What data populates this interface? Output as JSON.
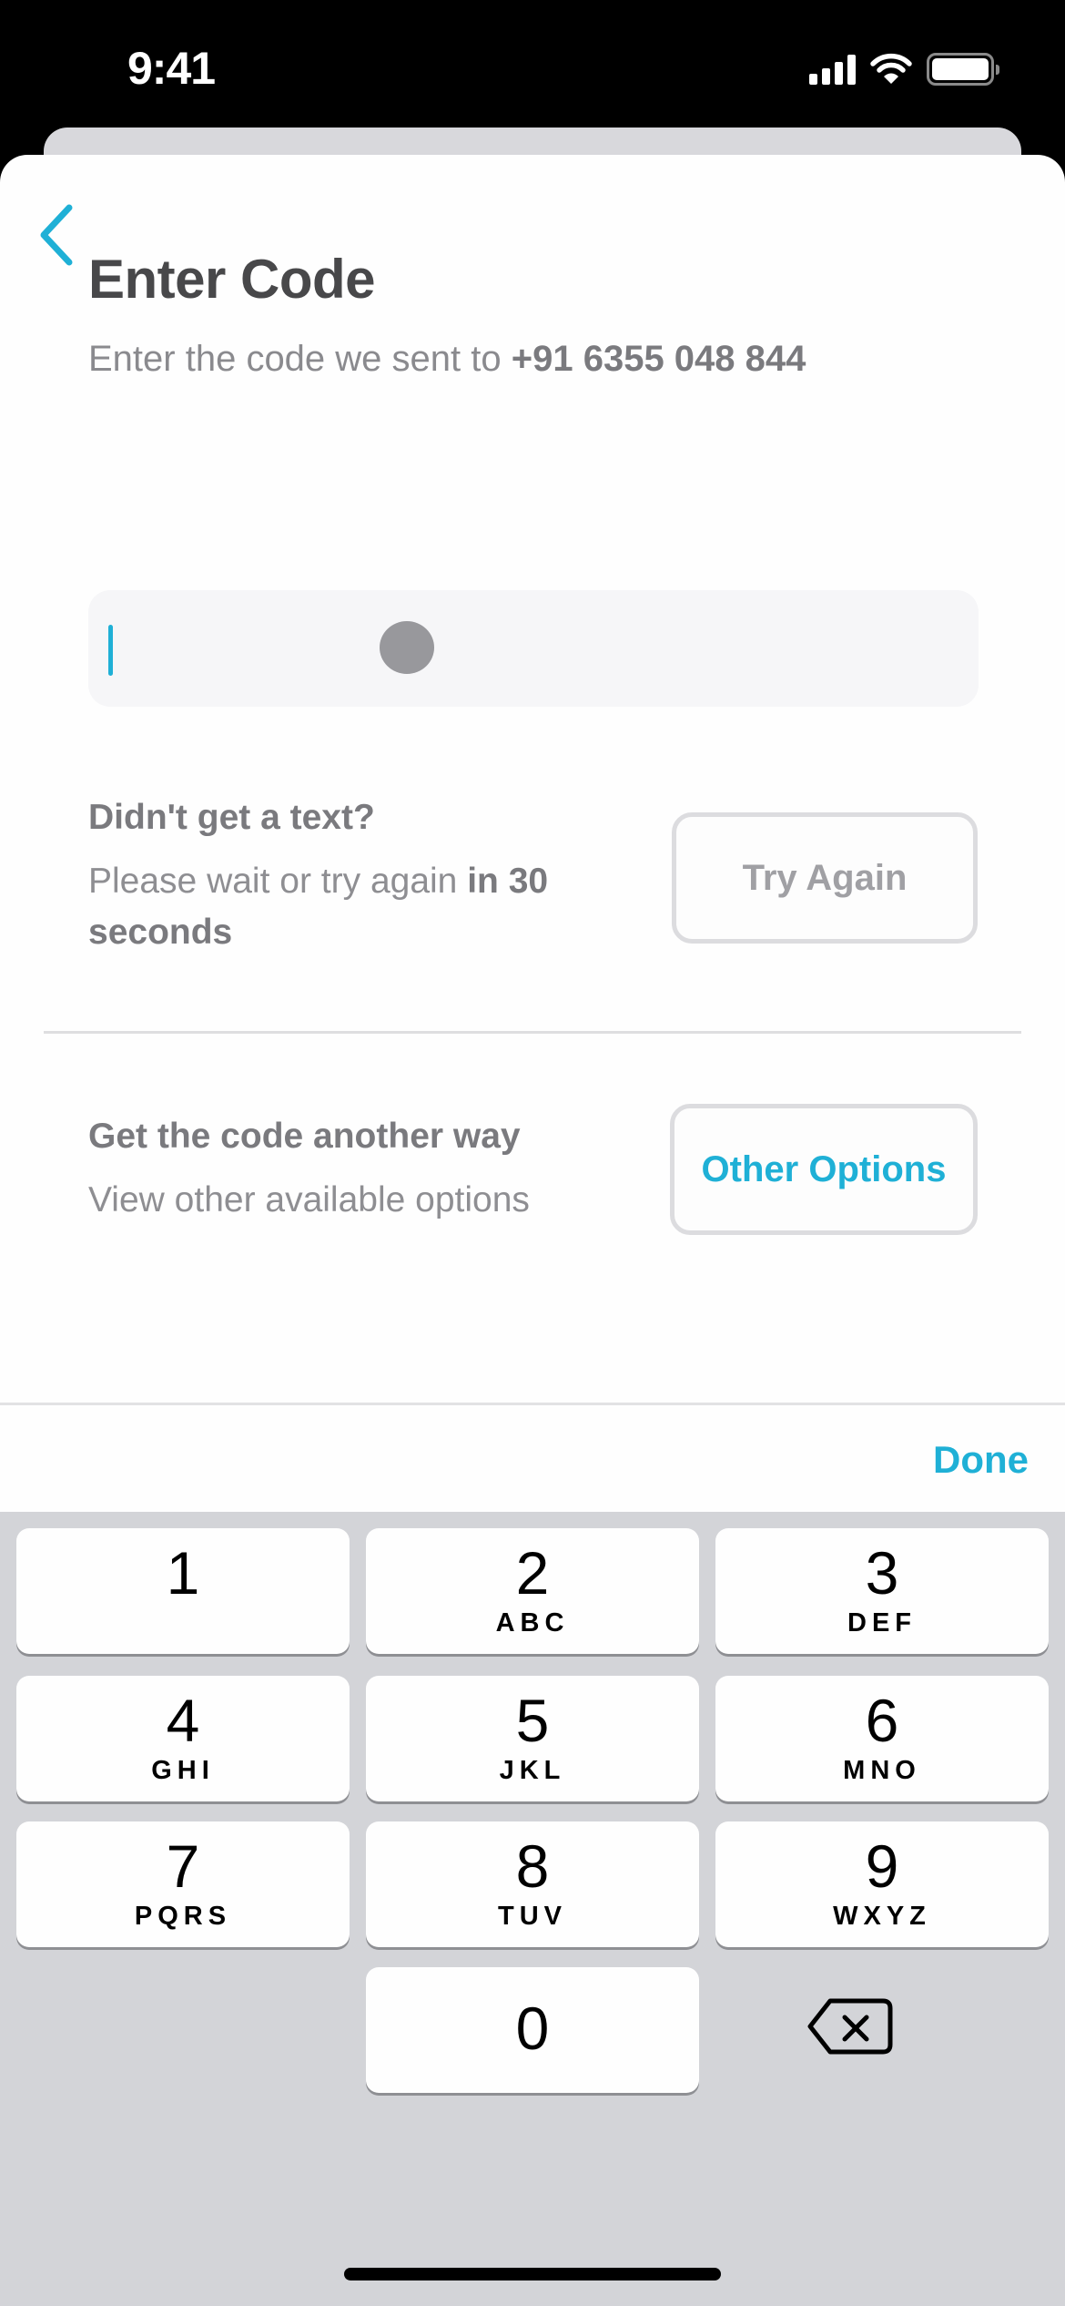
{
  "status_bar": {
    "time": "9:41",
    "icons": [
      "cellular-signal-icon",
      "wifi-icon",
      "battery-icon"
    ]
  },
  "header": {
    "back_icon": "chevron-left-icon"
  },
  "main": {
    "title": "Enter Code",
    "subtitle_prefix": "Enter the code we sent to ",
    "phone_number": "+91 6355 048 844",
    "code_input": {
      "value": ""
    },
    "resend": {
      "label": "Didn't get a text?",
      "desc_prefix": "Please wait or try again ",
      "desc_bold": "in 30",
      "desc_suffix": "seconds",
      "button_label": "Try Again",
      "button_disabled": true
    },
    "alternate": {
      "label": "Get the code another way",
      "desc": "View other available options",
      "button_label": "Other Options"
    }
  },
  "keyboard_toolbar": {
    "done_label": "Done"
  },
  "keypad": {
    "keys": [
      {
        "num": "1",
        "letters": ""
      },
      {
        "num": "2",
        "letters": "ABC"
      },
      {
        "num": "3",
        "letters": "DEF"
      },
      {
        "num": "4",
        "letters": "GHI"
      },
      {
        "num": "5",
        "letters": "JKL"
      },
      {
        "num": "6",
        "letters": "MNO"
      },
      {
        "num": "7",
        "letters": "PQRS"
      },
      {
        "num": "8",
        "letters": "TUV"
      },
      {
        "num": "9",
        "letters": "WXYZ"
      },
      {
        "num": "0",
        "letters": ""
      }
    ],
    "delete_icon": "backspace-icon"
  },
  "colors": {
    "accent": "#1fb0d6",
    "title": "#48484a",
    "muted": "#8a8a8e",
    "keyboard_bg": "#d3d4d8"
  }
}
